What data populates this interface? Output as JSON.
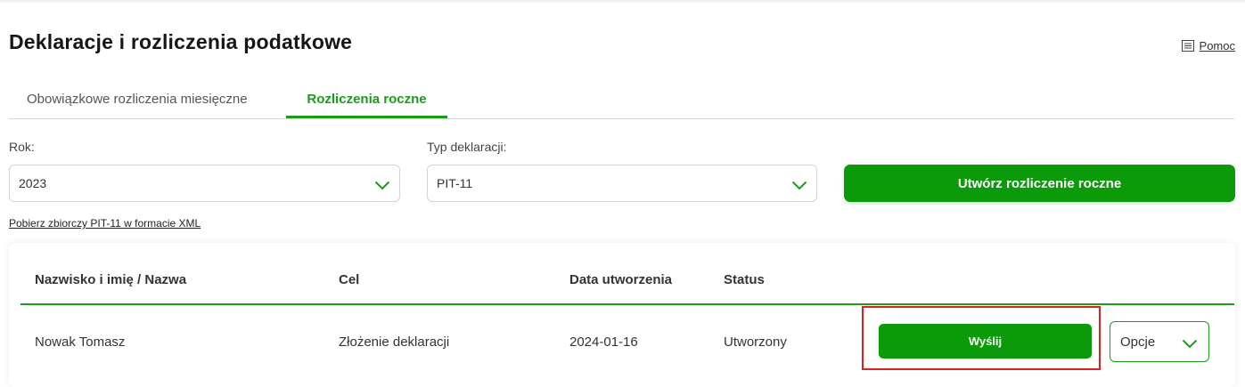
{
  "page": {
    "title": "Deklaracje i rozliczenia podatkowe",
    "help_label": "Pomoc"
  },
  "tabs": [
    {
      "label": "Obowiązkowe rozliczenia miesięczne",
      "active": false
    },
    {
      "label": "Rozliczenia roczne",
      "active": true
    }
  ],
  "filters": {
    "year_label": "Rok:",
    "year_value": "2023",
    "type_label": "Typ deklaracji:",
    "type_value": "PIT-11"
  },
  "create_button_label": "Utwórz rozliczenie roczne",
  "xml_link_label": "Pobierz zbiorczy PIT-11 w formacie XML",
  "table": {
    "columns": [
      "Nazwisko i imię / Nazwa",
      "Cel",
      "Data utworzenia",
      "Status"
    ],
    "rows": [
      {
        "name": "Nowak Tomasz",
        "goal": "Złożenie deklaracji",
        "created": "2024-01-16",
        "status": "Utworzony",
        "send_label": "Wyślij",
        "options_label": "Opcje"
      }
    ]
  },
  "icons": {
    "help": "document-list-icon",
    "select_arrow": "chevron-down-icon"
  },
  "colors": {
    "accent": "#0a9a0a",
    "highlight": "#e02020"
  }
}
